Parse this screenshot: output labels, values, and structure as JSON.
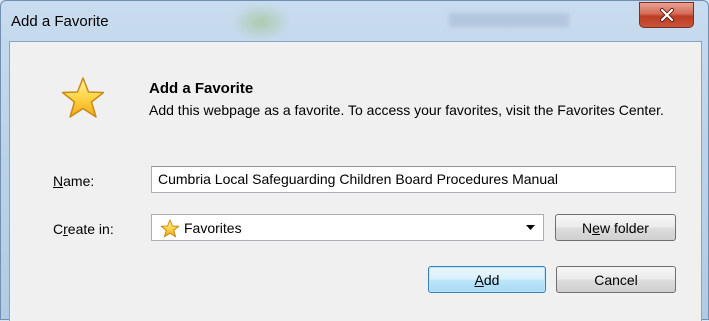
{
  "window": {
    "title": "Add a Favorite",
    "close_icon": "close-x-icon"
  },
  "header": {
    "icon": "favorite-star-icon",
    "heading": "Add a Favorite",
    "description": "Add this webpage as a favorite. To access your favorites, visit the Favorites Center."
  },
  "form": {
    "name_label_mnemonic": "N",
    "name_label_rest": "ame:",
    "name_value": "Cumbria Local Safeguarding Children Board Procedures Manual",
    "create_in_label_start": "C",
    "create_in_label_mnemonic": "r",
    "create_in_label_rest": "eate in:",
    "create_in_selected": "Favorites",
    "create_in_icon": "favorites-folder-star-icon"
  },
  "buttons": {
    "new_folder_start": "N",
    "new_folder_mnemonic": "e",
    "new_folder_rest": "w folder",
    "add_mnemonic": "A",
    "add_rest": "dd",
    "cancel": "Cancel"
  }
}
